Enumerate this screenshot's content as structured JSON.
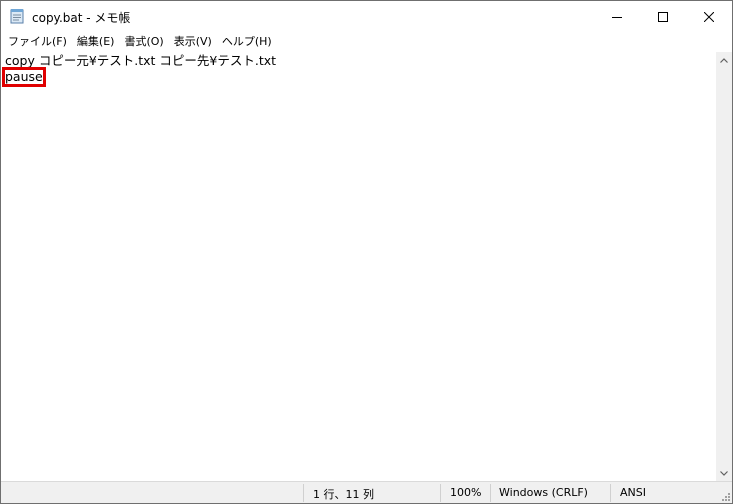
{
  "window": {
    "title": "copy.bat - メモ帳",
    "app_icon": "notepad-icon",
    "controls": {
      "minimize_icon": "minimize-icon",
      "maximize_icon": "maximize-icon",
      "close_icon": "close-icon"
    }
  },
  "menu": {
    "items": [
      {
        "label": "ファイル(F)"
      },
      {
        "label": "編集(E)"
      },
      {
        "label": "書式(O)"
      },
      {
        "label": "表示(V)"
      },
      {
        "label": "ヘルプ(H)"
      }
    ]
  },
  "editor": {
    "lines": [
      "copy コピー元¥テスト.txt コピー先¥テスト.txt",
      "pause"
    ],
    "highlight_color": "#e00000"
  },
  "status": {
    "position": "1 行、11 列",
    "zoom": "100%",
    "line_ending": "Windows (CRLF)",
    "encoding": "ANSI"
  },
  "colors": {
    "window_bg": "#ffffff",
    "statusbar_bg": "#f0f0f0",
    "scrollbar_bg": "#f0f0f0"
  }
}
